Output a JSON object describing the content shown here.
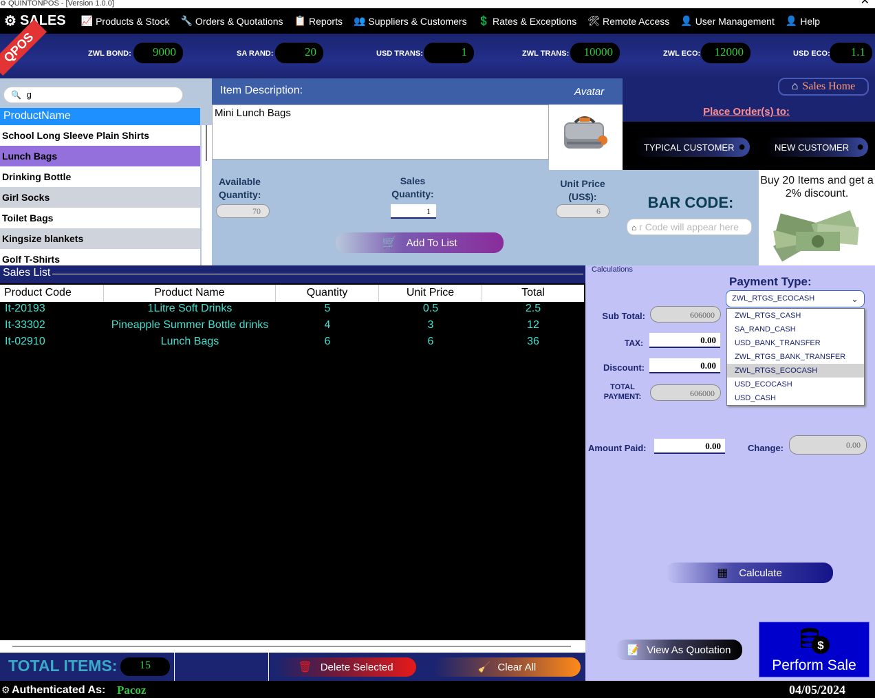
{
  "window": {
    "title": "QUINTONPOS - [Version 1.0.0]",
    "close": "✕"
  },
  "menu": {
    "brand": "SALES",
    "items": [
      {
        "label": "Products & Stock",
        "icon": "chart-icon"
      },
      {
        "label": "Orders & Quotations",
        "icon": "wrench-icon"
      },
      {
        "label": "Reports",
        "icon": "report-icon"
      },
      {
        "label": "Suppliers & Customers",
        "icon": "people-icon"
      },
      {
        "label": "Rates & Exceptions",
        "icon": "dollar-icon"
      },
      {
        "label": "Remote Access",
        "icon": "tools-icon"
      },
      {
        "label": "User Management",
        "icon": "users-icon"
      },
      {
        "label": "Help",
        "icon": "user-icon"
      }
    ]
  },
  "logo": "QPOS",
  "rates": [
    {
      "label": "ZWL BOND:",
      "value": "9000"
    },
    {
      "label": "SA RAND:",
      "value": "20"
    },
    {
      "label": "USD TRANS:",
      "value": "1"
    },
    {
      "label": "ZWL TRANS:",
      "value": "10000"
    },
    {
      "label": "ZWL ECO:",
      "value": "12000"
    },
    {
      "label": "USD ECO:",
      "value": "1.1"
    }
  ],
  "search": {
    "value": "g"
  },
  "products": {
    "header": "ProductName",
    "items": [
      "School Long Sleeve Plain Shirts",
      "Lunch Bags",
      "Drinking Bottle",
      "Girl Socks",
      "Toilet Bags",
      "Kingsize blankets",
      "Golf T-Shirts"
    ],
    "selected_index": 1
  },
  "item": {
    "desc_label": "Item Description:",
    "avatar_label": "Avatar",
    "description": "Mini Lunch Bags",
    "available_label": "Available Quantity:",
    "available_value": "70",
    "sales_qty_label": "Sales Quantity:",
    "sales_qty_value": "1",
    "unit_price_label": "Unit Price (US$):",
    "unit_price_value": "6",
    "add_button": "Add To List"
  },
  "orders": {
    "home_button": "Sales Home",
    "place_order": "Place Order(s) to:",
    "typical_customer": "TYPICAL CUSTOMER",
    "new_customer": "NEW CUSTOMER"
  },
  "barcode": {
    "title": "BAR CODE:",
    "placeholder": "r Code will appear here"
  },
  "promo": {
    "text": "Buy 20 Items and get a 2% discount."
  },
  "sales": {
    "title": "Sales List",
    "columns": [
      "Product Code",
      "Product Name",
      "Quantity",
      "Unit Price",
      "Total"
    ],
    "rows": [
      [
        "It-20193",
        "1Litre Soft Drinks",
        "5",
        "0.5",
        "2.5"
      ],
      [
        "It-33302",
        "Pineapple Summer Bottle drinks",
        "4",
        "3",
        "12"
      ],
      [
        "It-02910",
        "Lunch Bags",
        "6",
        "6",
        "36"
      ]
    ],
    "total_items_label": "TOTAL ITEMS:",
    "total_items_value": "15",
    "delete_button": "Delete Selected",
    "clear_button": "Clear All"
  },
  "calc": {
    "section_label": "Calculations",
    "payment_type_label": "Payment Type:",
    "payment_selected": "ZWL_RTGS_ECOCASH",
    "payment_options": [
      "ZWL_RTGS_CASH",
      "SA_RAND_CASH",
      "USD_BANK_TRANSFER",
      "ZWL_RTGS_BANK_TRANSFER",
      "ZWL_RTGS_ECOCASH",
      "USD_ECOCASH",
      "USD_CASH"
    ],
    "subtotal_label": "Sub Total:",
    "subtotal_value": "606000",
    "tax_label": "TAX:",
    "tax_value": "0.00",
    "discount_label": "Discount:",
    "discount_value": "0.00",
    "total_label": "TOTAL PAYMENT:",
    "total_value": "606000",
    "amount_paid_label": "Amount Paid:",
    "amount_paid_value": "0.00",
    "change_label": "Change:",
    "change_value": "0.00",
    "calculate_button": "Calculate",
    "quotation_button": "View As Quotation",
    "perform_button": "Perform Sale"
  },
  "status": {
    "auth_label": "Authenticated As:",
    "user": "Pacoz",
    "date": "04/05/2024"
  }
}
